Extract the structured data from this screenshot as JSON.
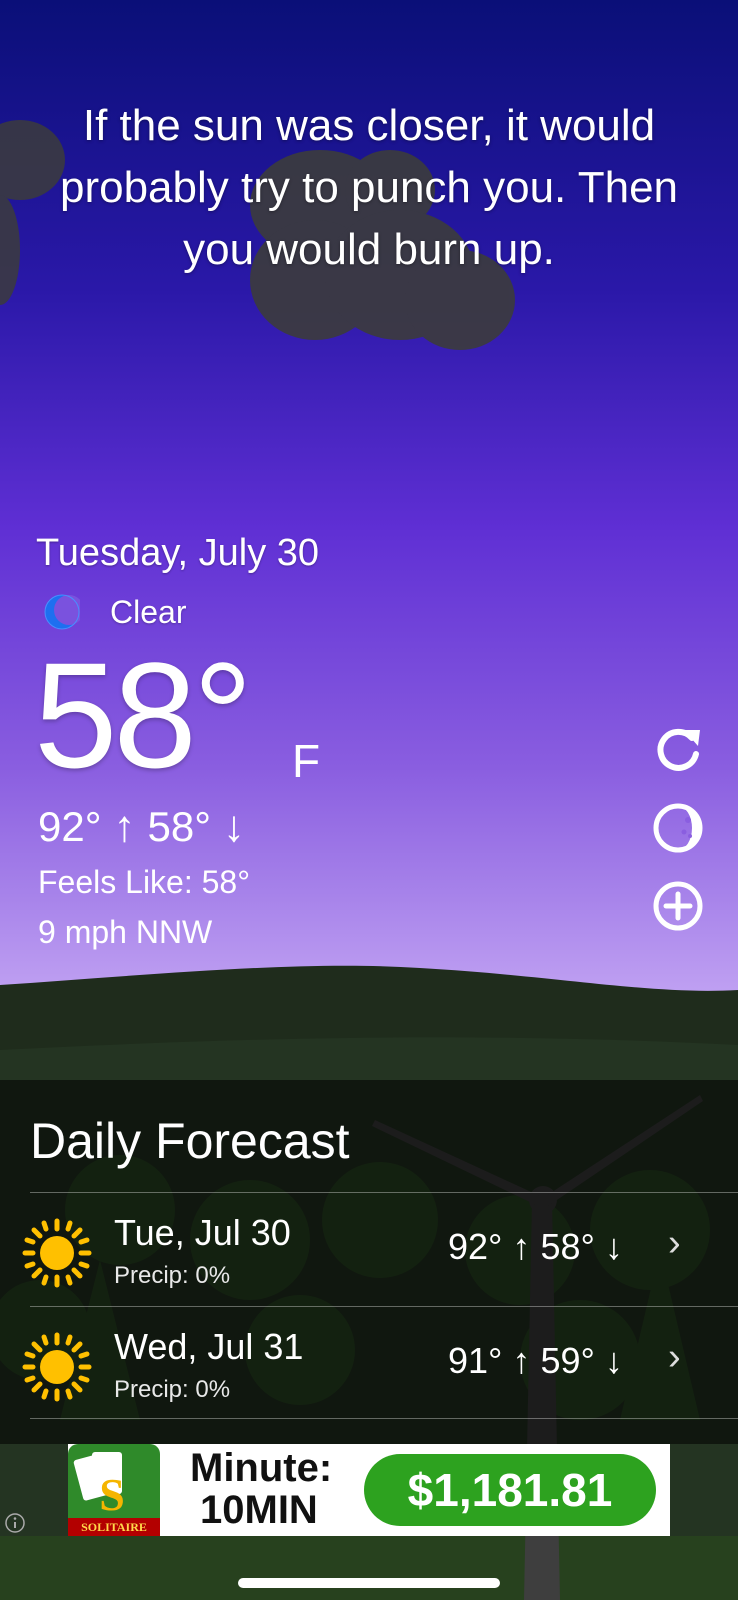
{
  "quote": "If the sun was closer, it would probably try to punch you. Then you would burn up.",
  "current": {
    "date": "Tuesday, July 30",
    "condition": "Clear",
    "condition_icon": "moon-icon",
    "temperature": "58°",
    "unit": "F",
    "high": "92°",
    "low": "58°",
    "feels_like": "Feels Like: 58°",
    "wind": "9 mph NNW"
  },
  "actions": {
    "refresh_icon": "refresh-icon",
    "theme_icon": "moon-phase-icon",
    "add_icon": "add-location-icon"
  },
  "daily_forecast": {
    "title": "Daily Forecast",
    "days": [
      {
        "day": "Tue, Jul 30",
        "precip": "Precip: 0%",
        "high": "92°",
        "low": "58°",
        "icon": "sun-icon"
      },
      {
        "day": "Wed, Jul 31",
        "precip": "Precip: 0%",
        "high": "91°",
        "low": "59°",
        "icon": "sun-icon"
      }
    ]
  },
  "ad": {
    "brand": "SOLITAIRE",
    "line1": "Minute:",
    "line2": "10MIN",
    "amount": "$1,181.81"
  },
  "colors": {
    "sky_top": "#0a0f78",
    "sky_bottom": "#bfa0f2",
    "sun": "#ffc000",
    "ad_green": "#2da21f"
  }
}
